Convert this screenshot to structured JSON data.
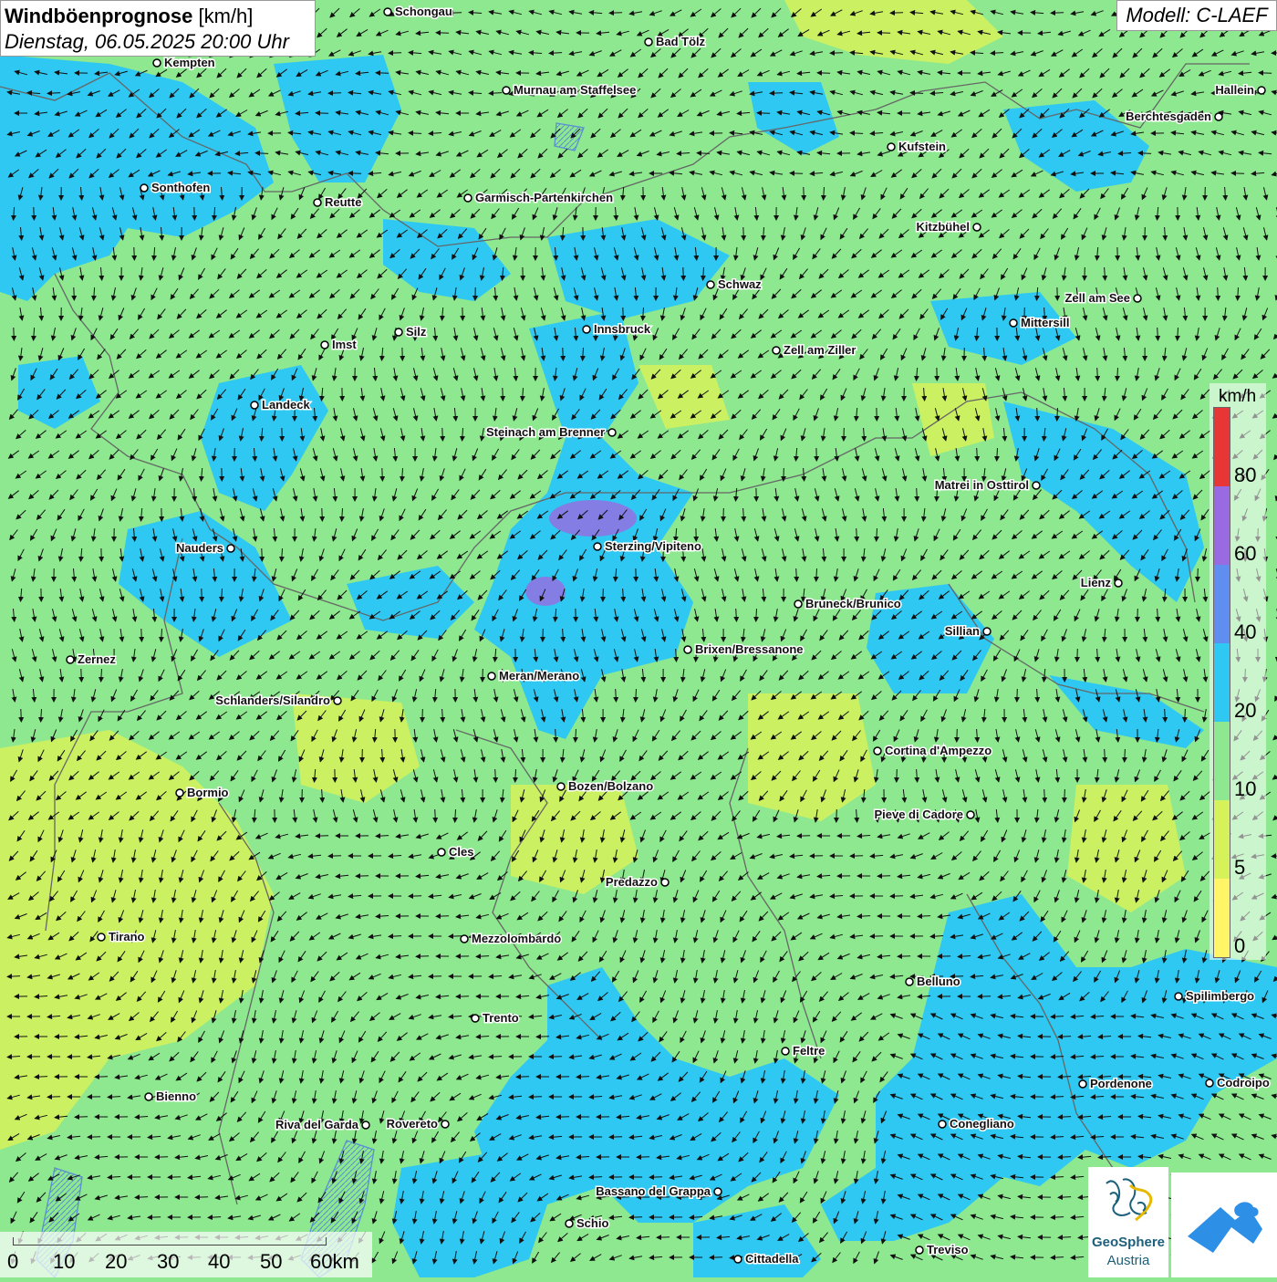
{
  "title": {
    "main": "Windböenprognose",
    "unit": "[km/h]",
    "datetime": "Dienstag, 06.05.2025 20:00 Uhr"
  },
  "model": "Modell: C-LAEF",
  "legend": {
    "unit": "km/h",
    "ticks": [
      "80",
      "60",
      "40",
      "20",
      "10",
      "5",
      "0"
    ],
    "colors": [
      "#f0f0f8",
      "#e83535",
      "#9a6be0",
      "#5f8ef0",
      "#2ec8f2",
      "#8de88f",
      "#d6f25b",
      "#fff566"
    ]
  },
  "scalebar": {
    "labels": [
      "0",
      "10",
      "20",
      "30",
      "40",
      "50",
      "60km"
    ]
  },
  "logo": {
    "name": "GeoSphere",
    "sub": "Austria"
  },
  "cities": [
    {
      "name": "Schongau"
    },
    {
      "name": "Bad Tölz"
    },
    {
      "name": "Kempten"
    },
    {
      "name": "Murnau am Staffelsee"
    },
    {
      "name": "Hallein"
    },
    {
      "name": "Berchtesgaden"
    },
    {
      "name": "Kufstein"
    },
    {
      "name": "Sonthofen"
    },
    {
      "name": "Reutte"
    },
    {
      "name": "Garmisch-Partenkirchen"
    },
    {
      "name": "Kitzbühel"
    },
    {
      "name": "Schwaz"
    },
    {
      "name": "Zell am See"
    },
    {
      "name": "Silz"
    },
    {
      "name": "Innsbruck"
    },
    {
      "name": "Mittersill"
    },
    {
      "name": "Imst"
    },
    {
      "name": "Zell am Ziller"
    },
    {
      "name": "Landeck"
    },
    {
      "name": "Steinach am Brenner"
    },
    {
      "name": "Matrei in Osttirol"
    },
    {
      "name": "Nauders"
    },
    {
      "name": "Sterzing/Vipiteno"
    },
    {
      "name": "Lienz"
    },
    {
      "name": "Bruneck/Brunico"
    },
    {
      "name": "Sillian"
    },
    {
      "name": "Brixen/Bressanone"
    },
    {
      "name": "Zernez"
    },
    {
      "name": "Meran/Merano"
    },
    {
      "name": "Schlanders/Silandro"
    },
    {
      "name": "Cortina d'Ampezzo"
    },
    {
      "name": "Bozen/Bolzano"
    },
    {
      "name": "Bormio"
    },
    {
      "name": "Pieve di Cadore"
    },
    {
      "name": "Cles"
    },
    {
      "name": "Predazzo"
    },
    {
      "name": "Tirano"
    },
    {
      "name": "Mezzolombardo"
    },
    {
      "name": "Belluno"
    },
    {
      "name": "Spilimbergo"
    },
    {
      "name": "Trento"
    },
    {
      "name": "Feltre"
    },
    {
      "name": "Pordenone"
    },
    {
      "name": "Codroipo"
    },
    {
      "name": "Bienno"
    },
    {
      "name": "Riva del Garda"
    },
    {
      "name": "Rovereto"
    },
    {
      "name": "Conegliano"
    },
    {
      "name": "Bassano del Grappa"
    },
    {
      "name": "Schio"
    },
    {
      "name": "Treviso"
    },
    {
      "name": "Cittadella"
    }
  ]
}
